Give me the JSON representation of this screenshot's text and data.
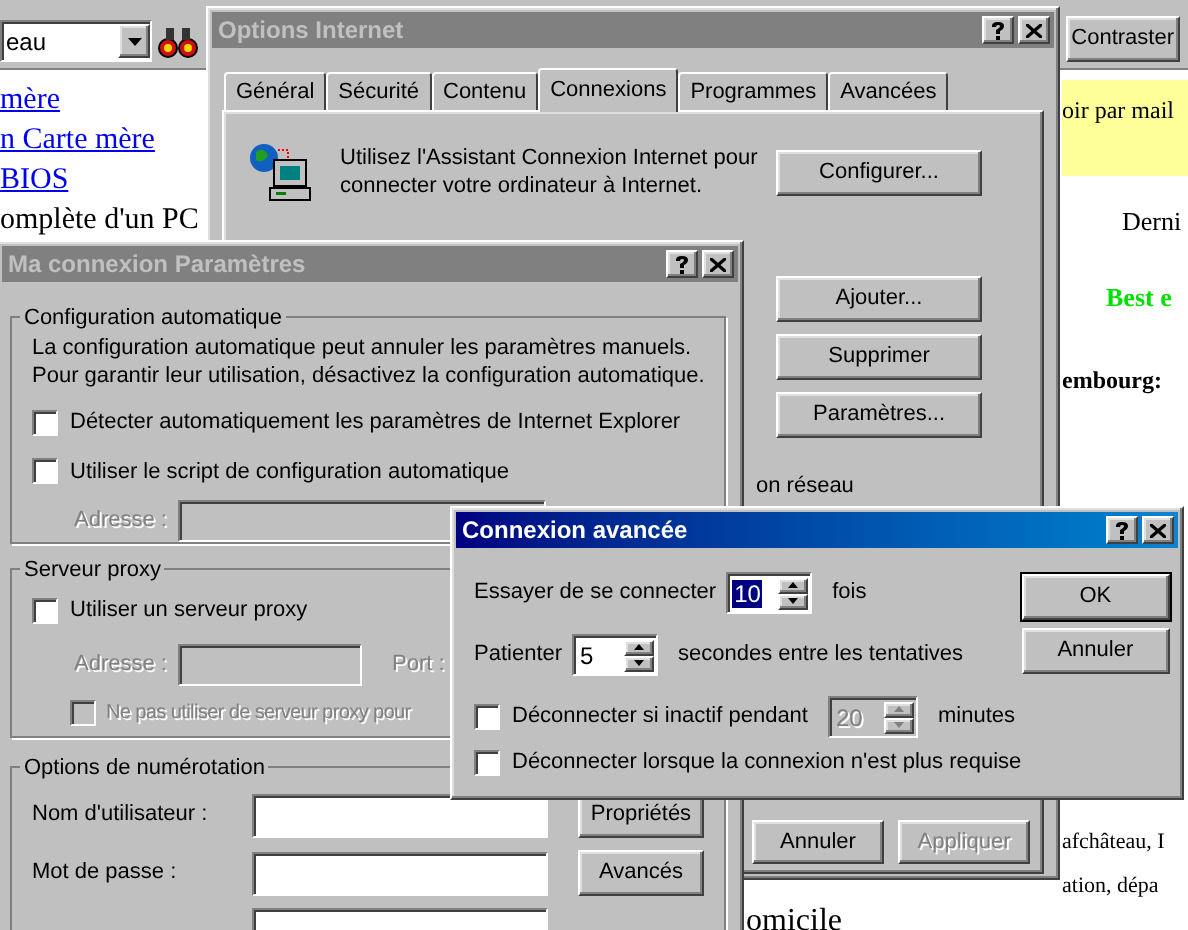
{
  "browser": {
    "address": "eau",
    "toolbar_button": "Contraster",
    "links": [
      "mère",
      "n Carte mère",
      "BIOS"
    ],
    "left_text": "omplète d'un PC",
    "banner": "oir par mail",
    "right_text": "Derni",
    "highlight": "Best e",
    "heading": "embourg:",
    "right_bottom": [
      "afchâteau, I",
      "ation, dépa"
    ],
    "bottom_text": "omicile"
  },
  "options_internet": {
    "title": "Options Internet",
    "tabs": [
      {
        "label": "Général",
        "selected": false
      },
      {
        "label": "Sécurité",
        "selected": false
      },
      {
        "label": "Contenu",
        "selected": false
      },
      {
        "label": "Connexions",
        "selected": true
      },
      {
        "label": "Programmes",
        "selected": false
      },
      {
        "label": "Avancées",
        "selected": false
      }
    ],
    "wizard_lines": [
      "Utilisez l'Assistant Connexion Internet pour",
      "connecter votre ordinateur à Internet."
    ],
    "configure_button": "Configurer...",
    "side_buttons": [
      "Ajouter...",
      "Supprimer",
      "Paramètres..."
    ],
    "partial_label": "on réseau",
    "footer_buttons": [
      {
        "label": "Annuler",
        "disabled": false
      },
      {
        "label": "Appliquer",
        "disabled": true
      }
    ]
  },
  "connection_settings": {
    "title": "Ma connexion Paramètres",
    "auto_config": {
      "label": "Configuration automatique",
      "description": "La configuration automatique peut annuler les paramètres manuels. Pour garantir leur utilisation, désactivez la configuration automatique.",
      "checkboxes": [
        {
          "label": "Détecter automatiquement les paramètres de Internet Explorer",
          "checked": false
        },
        {
          "label": "Utiliser le script de configuration automatique",
          "checked": false
        }
      ],
      "address_label": "Adresse :",
      "address_disabled": true
    },
    "proxy": {
      "label": "Serveur proxy",
      "checkbox": {
        "label": "Utiliser un serveur proxy",
        "checked": false
      },
      "address_label": "Adresse :",
      "port_label": "Port :",
      "fields_disabled": true,
      "bypass": {
        "label": "Ne pas utiliser de serveur proxy pour",
        "checked": false,
        "disabled": true
      }
    },
    "dialing": {
      "label": "Options de numérotation",
      "fields": [
        {
          "label": "Nom d'utilisateur :",
          "button": "Propriétés"
        },
        {
          "label": "Mot de passe :",
          "button": "Avancés"
        }
      ]
    }
  },
  "advanced": {
    "title": "Connexion avancée",
    "rows": [
      {
        "kind": "spinner",
        "label": "Essayer de se connecter",
        "value": "10",
        "selected": true,
        "suffix": "fois"
      },
      {
        "kind": "spinner",
        "label": "Patienter",
        "value": "5",
        "selected": false,
        "suffix": "secondes entre les tentatives"
      },
      {
        "kind": "checkspin",
        "label": "Déconnecter si inactif pendant",
        "checked": false,
        "value": "20",
        "disabled": true,
        "suffix": "minutes"
      },
      {
        "kind": "checkbox",
        "label": "Déconnecter lorsque la connexion n'est plus requise",
        "checked": false
      }
    ],
    "buttons": [
      {
        "label": "OK",
        "default": true
      },
      {
        "label": "Annuler",
        "default": false
      }
    ]
  }
}
